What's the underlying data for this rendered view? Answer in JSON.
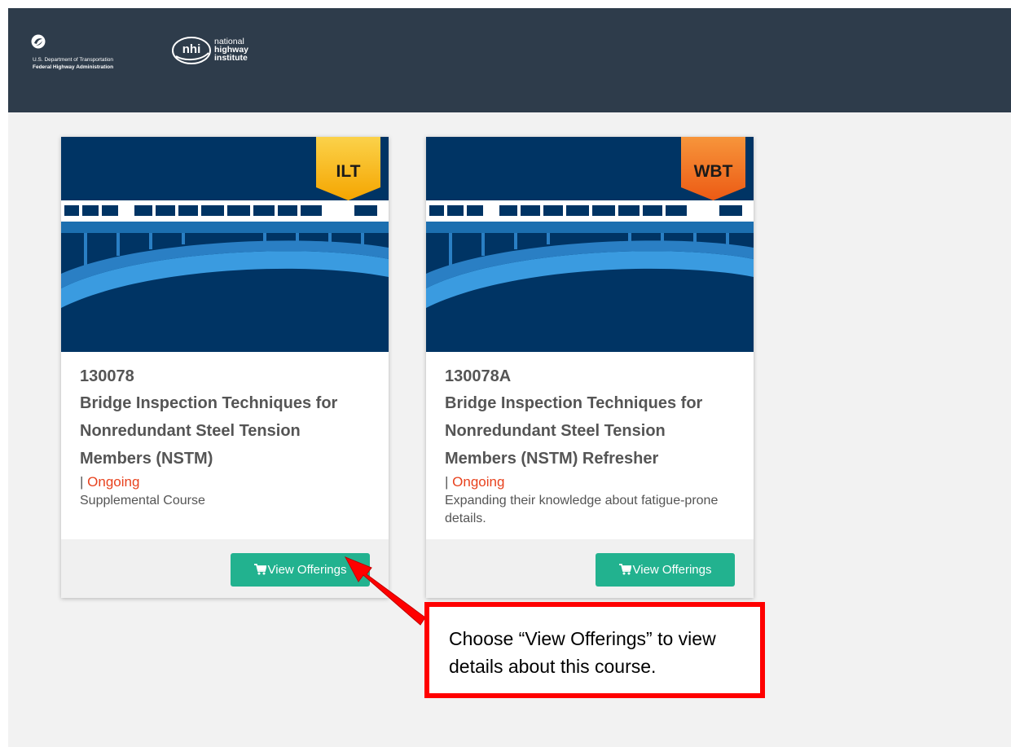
{
  "header": {
    "dot_department": "U.S. Department of Transportation",
    "dot_admin": "Federal Highway Administration",
    "nhi_mark": "nhi",
    "nhi_line1": "national",
    "nhi_line2": "highway",
    "nhi_line3": "institute"
  },
  "cards": [
    {
      "badge": "ILT",
      "badge_color": "#f9b40f",
      "course_number": "130078",
      "title": "Bridge Inspection Techniques for Nonredundant Steel Tension Members (NSTM)",
      "status_prefix": "| ",
      "status": "Ongoing",
      "description": "Supplemental Course",
      "button_label": "View Offerings"
    },
    {
      "badge": "WBT",
      "badge_color": "#f06a1e",
      "course_number": "130078A",
      "title": "Bridge Inspection Techniques for Nonredundant Steel Tension Members (NSTM) Refresher",
      "status_prefix": "| ",
      "status": "Ongoing",
      "description": "Expanding their knowledge about fatigue-prone details.",
      "button_label": "View Offerings"
    }
  ],
  "annotation": {
    "text": "Choose “View Offerings” to view details about this course."
  },
  "colors": {
    "header_bg": "#2e3c4b",
    "button": "#22b28f",
    "status": "#e8421e",
    "callout": "#ff0000"
  },
  "icons": {
    "dot": "dot-logo-icon",
    "nhi": "nhi-logo-icon",
    "cart": "cart-icon",
    "arrow": "red-arrow-icon"
  }
}
